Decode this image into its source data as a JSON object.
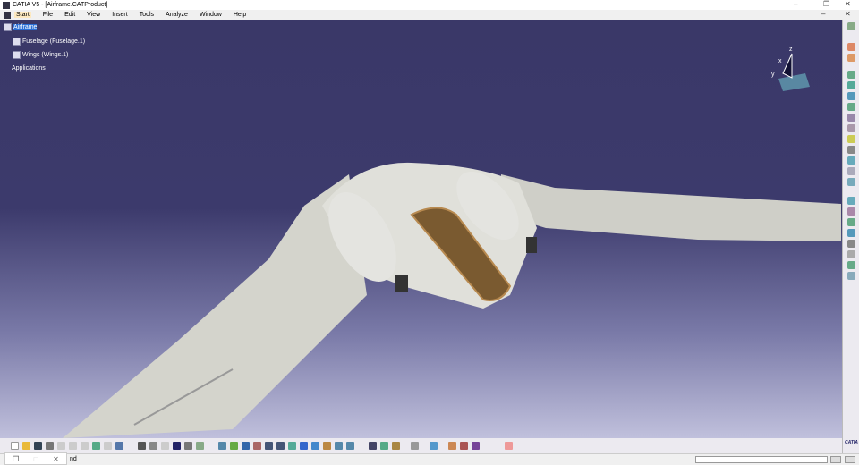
{
  "window": {
    "title": "CATIA V5 - [Airframe.CATProduct]"
  },
  "menu": [
    "Start",
    "File",
    "Edit",
    "View",
    "Insert",
    "Tools",
    "Analyze",
    "Window",
    "Help"
  ],
  "tree": {
    "root": "Airframe",
    "children": [
      "Fuselage (Fuselage.1)",
      "Wings (Wings.1)",
      "Applications"
    ]
  },
  "status": {
    "text": "nd"
  },
  "compass": {
    "x": "x",
    "y": "y",
    "z": "z"
  },
  "logo": "CATIA",
  "colors": {
    "background_top": "#3a3868",
    "background_bottom": "#c0c0dc",
    "selection": "#2a6fd6"
  }
}
